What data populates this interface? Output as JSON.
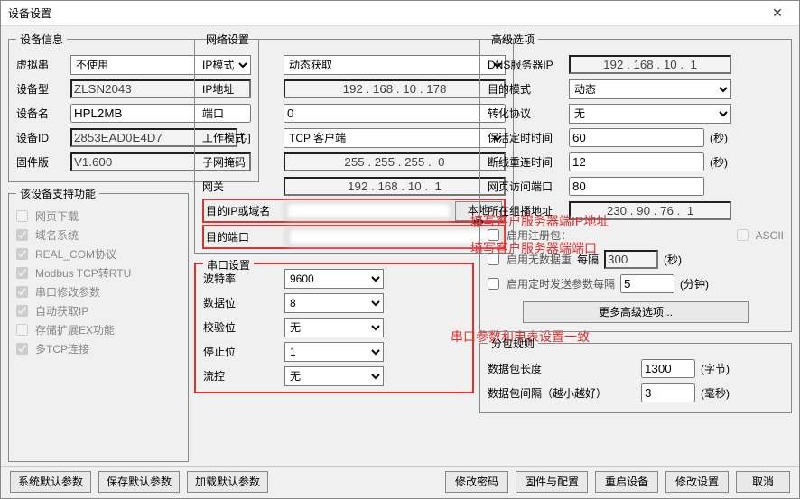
{
  "window": {
    "title": "设备设置",
    "close": "✕"
  },
  "device_info": {
    "legend": "设备信息",
    "virtual_com_label": "虚拟串",
    "virtual_com_value": "不使用",
    "device_type_label": "设备型",
    "device_type_value": "ZLSN2043",
    "device_name_label": "设备名",
    "device_name_value": "HPL2MB",
    "device_id_label": "设备ID",
    "device_id_value": "2853EAD0E4D7",
    "device_id_suffix": "[-]",
    "firmware_label": "固件版",
    "firmware_value": "V1.600"
  },
  "features": {
    "legend": "该设备支持功能",
    "items": [
      {
        "label": "网页下载",
        "checked": false,
        "enabled": false
      },
      {
        "label": "域名系统",
        "checked": true,
        "enabled": false
      },
      {
        "label": "REAL_COM协议",
        "checked": true,
        "enabled": false
      },
      {
        "label": "Modbus TCP转RTU",
        "checked": true,
        "enabled": false
      },
      {
        "label": "串口修改参数",
        "checked": true,
        "enabled": false
      },
      {
        "label": "自动获取IP",
        "checked": true,
        "enabled": false
      },
      {
        "label": "存储扩展EX功能",
        "checked": false,
        "enabled": false
      },
      {
        "label": "多TCP连接",
        "checked": true,
        "enabled": false
      }
    ]
  },
  "network": {
    "legend": "网络设置",
    "ip_mode_label": "IP模式",
    "ip_mode_value": "动态获取",
    "ip_addr_label": "IP地址",
    "ip_addr_value": "192 . 168 . 10 . 178",
    "port_label": "端口",
    "port_value": "0",
    "work_mode_label": "工作模式",
    "work_mode_value": "TCP 客户端",
    "subnet_label": "子网掩码",
    "subnet_value": "255 . 255 . 255 .  0",
    "gateway_label": "网关",
    "gateway_value": "192 . 168 . 10 .  1",
    "dest_ip_label": "目的IP或域名",
    "dest_ip_value": "",
    "local_ip_btn": "本地IP",
    "dest_port_label": "目的端口",
    "dest_port_value": ""
  },
  "serial": {
    "legend": "串口设置",
    "baud_label": "波特率",
    "baud_value": "9600",
    "databits_label": "数据位",
    "databits_value": "8",
    "parity_label": "校验位",
    "parity_value": "无",
    "stopbits_label": "停止位",
    "stopbits_value": "1",
    "flowctrl_label": "流控",
    "flowctrl_value": "无"
  },
  "advanced": {
    "legend": "高级选项",
    "dns_label": "DNS服务器IP",
    "dns_value": "192 . 168 . 10 .  1",
    "dest_mode_label": "目的模式",
    "dest_mode_value": "动态",
    "proto_label": "转化协议",
    "proto_value": "无",
    "keepalive_label": "保活定时时间",
    "keepalive_value": "60",
    "keepalive_unit": "(秒)",
    "reconnect_label": "断线重连时间",
    "reconnect_value": "12",
    "reconnect_unit": "(秒)",
    "web_port_label": "网页访问端口",
    "web_port_value": "80",
    "multicast_label": "所在组播地址",
    "multicast_value": "230 . 90 . 76 .  1",
    "reg_pkt_label": "启用注册包：",
    "reg_pkt_checked": false,
    "ascii_label": "ASCII",
    "nodata_label": "启用无数据重 ",
    "nodata_every": "每隔",
    "nodata_value": "300",
    "nodata_unit": "(秒)",
    "timed_label": "启用定时发送参数每隔",
    "timed_value": "5",
    "timed_unit": "(分钟)",
    "more_btn": "更多高级选项..."
  },
  "packet": {
    "legend": "分包规则",
    "len_label": "数据包长度",
    "len_value": "1300",
    "len_unit": "(字节)",
    "interval_label": "数据包间隔（越小越好）",
    "interval_value": "3",
    "interval_unit": "(毫秒)"
  },
  "annotations": {
    "a1": "填写客户服务器端IP地址",
    "a2": "填写客户服务器端端口",
    "a3": "串口参数和电表设置一致"
  },
  "buttons": {
    "sys_default": "系统默认参数",
    "save_default": "保存默认参数",
    "load_default": "加载默认参数",
    "change_pwd": "修改密码",
    "fw_config": "固件与配置",
    "restart": "重启设备",
    "apply": "修改设置",
    "cancel": "取消"
  }
}
